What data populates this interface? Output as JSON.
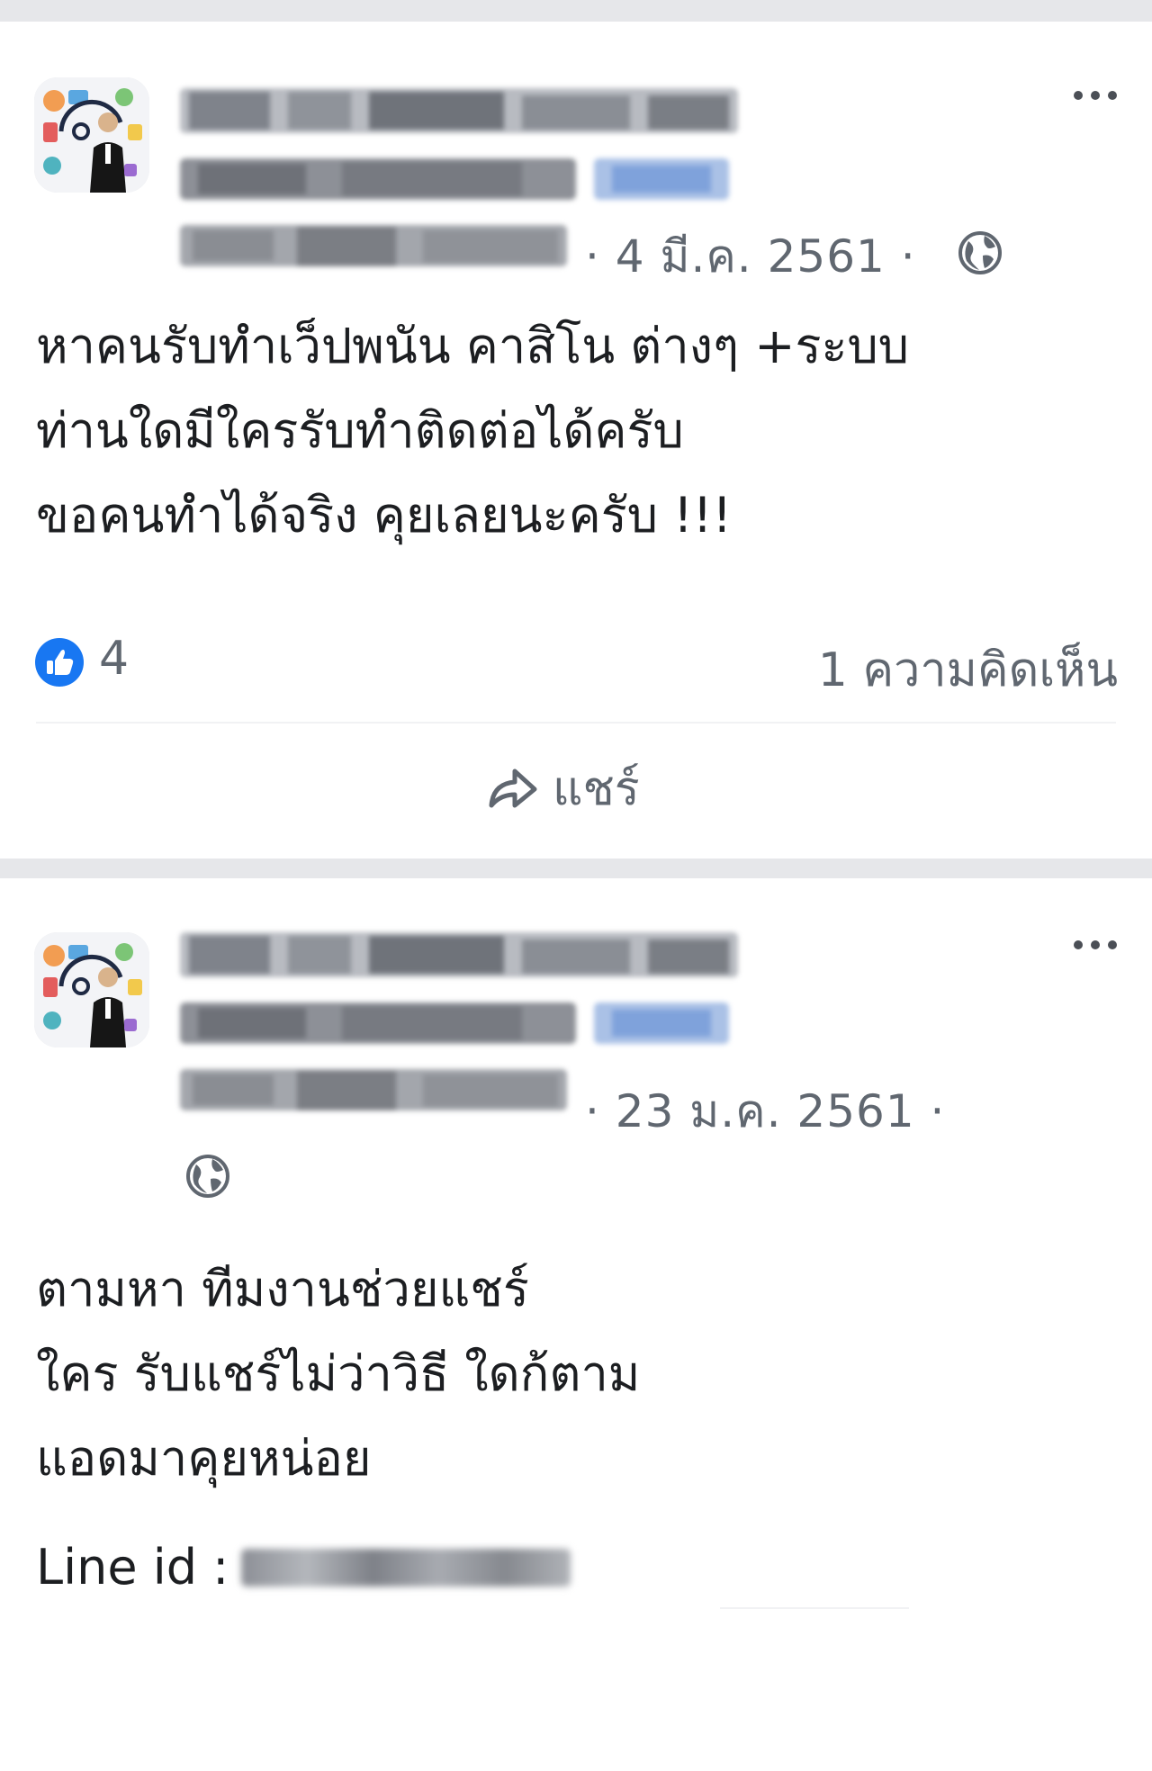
{
  "posts": [
    {
      "date": "· 4 มี.ค. 2561 ·",
      "privacy_icon": "globe-icon",
      "more_icon": "more-options-icon",
      "lines": [
        "หาคนรับทำเว็ปพนัน คาสิโน ต่างๆ  +ระบบ",
        "ท่านใดมีใครรับทำติดต่อได้ครับ",
        "ขอคนทำได้จริง คุยเลยนะครับ !!!"
      ],
      "reactions": {
        "icon": "like-icon",
        "count": "4"
      },
      "comments": "1 ความคิดเห็น",
      "share": {
        "icon": "share-icon",
        "label": "แชร์"
      }
    },
    {
      "date": "· 23 ม.ค. 2561 ·",
      "privacy_icon": "globe-icon",
      "more_icon": "more-options-icon",
      "lines": [
        "ตามหา ทีมงานช่วยแชร์",
        "ใคร รับแชร์ไม่ว่าวิธี ใดก้ตาม",
        "แอดมาคุยหน่อย"
      ],
      "line_id_label": "Line id :"
    }
  ],
  "colors": {
    "separator": "#e6e7ea",
    "secondary_text": "#606770",
    "primary_text": "#1c1e21",
    "like_blue": "#1877f2"
  }
}
